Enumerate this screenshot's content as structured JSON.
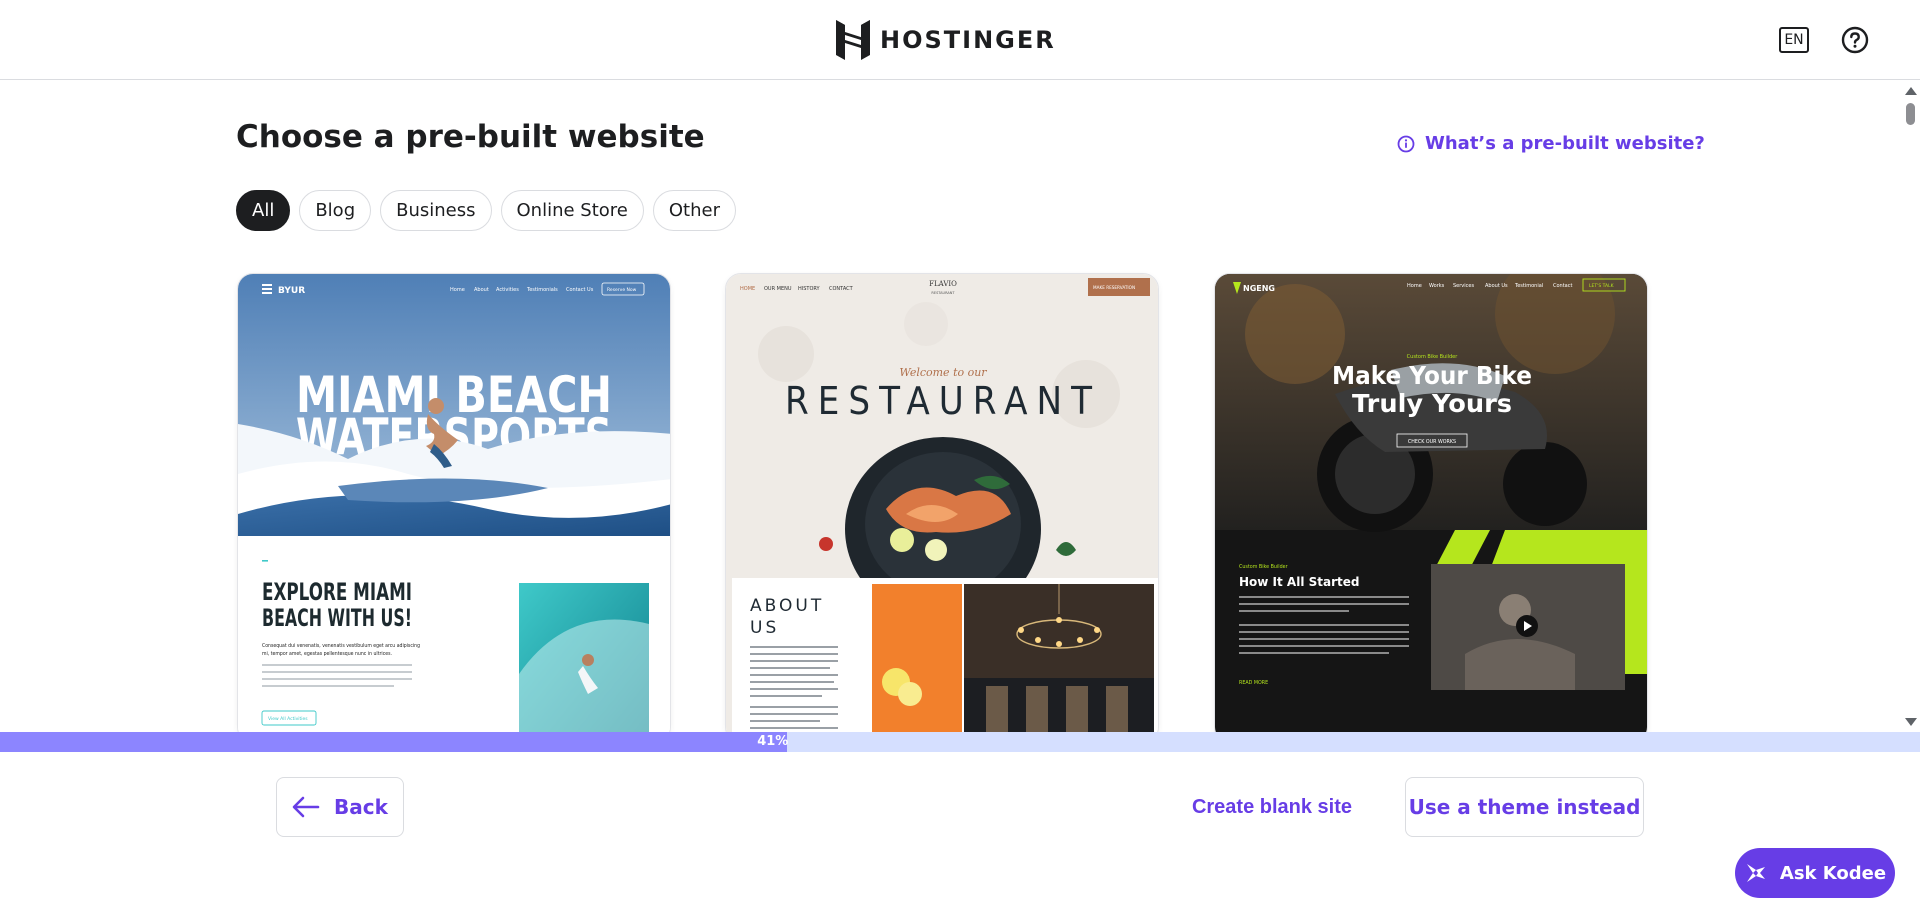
{
  "header": {
    "brand": "HOSTINGER",
    "language": "EN"
  },
  "main": {
    "title": "Choose a pre-built website",
    "help_link": "What’s a pre-built website?",
    "filters": [
      {
        "label": "All",
        "active": true
      },
      {
        "label": "Blog",
        "active": false
      },
      {
        "label": "Business",
        "active": false
      },
      {
        "label": "Online Store",
        "active": false
      },
      {
        "label": "Other",
        "active": false
      }
    ],
    "templates": [
      {
        "name": "BYUR",
        "nav": [
          "Home",
          "About",
          "Activities",
          "Testimonials",
          "Contact Us"
        ],
        "nav_button": "Reserve Now",
        "hero_line1": "MIAMI BEACH",
        "hero_line2": "WATERSPORTS",
        "heading_line1": "EXPLORE MIAMI",
        "heading_line2": "BEACH WITH US!",
        "body_line1": "Consequat dui venenatis, venenatis vestibulum eget arcu adipiscing",
        "body_line2": "mi, tempor amet, egestas pellentesque nunc in ultrices.",
        "cta": "View All Activities"
      },
      {
        "name": "FLAVIO",
        "subtitle": "RESTAURANT",
        "nav": [
          "HOME",
          "OUR MENU",
          "HISTORY",
          "CONTACT"
        ],
        "nav_button": "MAKE RESERVATION",
        "welcome": "Welcome to our",
        "hero": "RESTAURANT",
        "about_line1": "ABOUT",
        "about_line2": "US"
      },
      {
        "name": "NGENG",
        "nav": [
          "Home",
          "Works",
          "Services",
          "About Us",
          "Testimonial",
          "Contact"
        ],
        "nav_button": "LET'S TALK",
        "eyebrow": "Custom Bike Builder",
        "hero_line1": "Make Your Bike",
        "hero_line2": "Truly Yours",
        "cta": "CHECK OUR WORKS",
        "eyebrow2": "Custom Bike Builder",
        "section_title": "How It All Started",
        "read_more": "READ MORE"
      }
    ]
  },
  "progress": {
    "percent": 41,
    "label": "41%"
  },
  "footer": {
    "back": "Back",
    "create_blank": "Create blank site",
    "use_theme": "Use a theme instead"
  },
  "assistant": {
    "label": "Ask Kodee"
  },
  "colors": {
    "accent": "#673de6",
    "dark": "#1d1e20",
    "progress_track": "#d5dfff",
    "progress_fill": "#8c85ff",
    "ngeng_green": "#b5e61d"
  },
  "icons": {
    "logo": "hostinger-logo-icon",
    "help": "question-circle-icon",
    "info": "info-circle-icon",
    "back": "arrow-left-icon",
    "kodee": "kodee-sparkle-icon",
    "play": "play-icon"
  }
}
